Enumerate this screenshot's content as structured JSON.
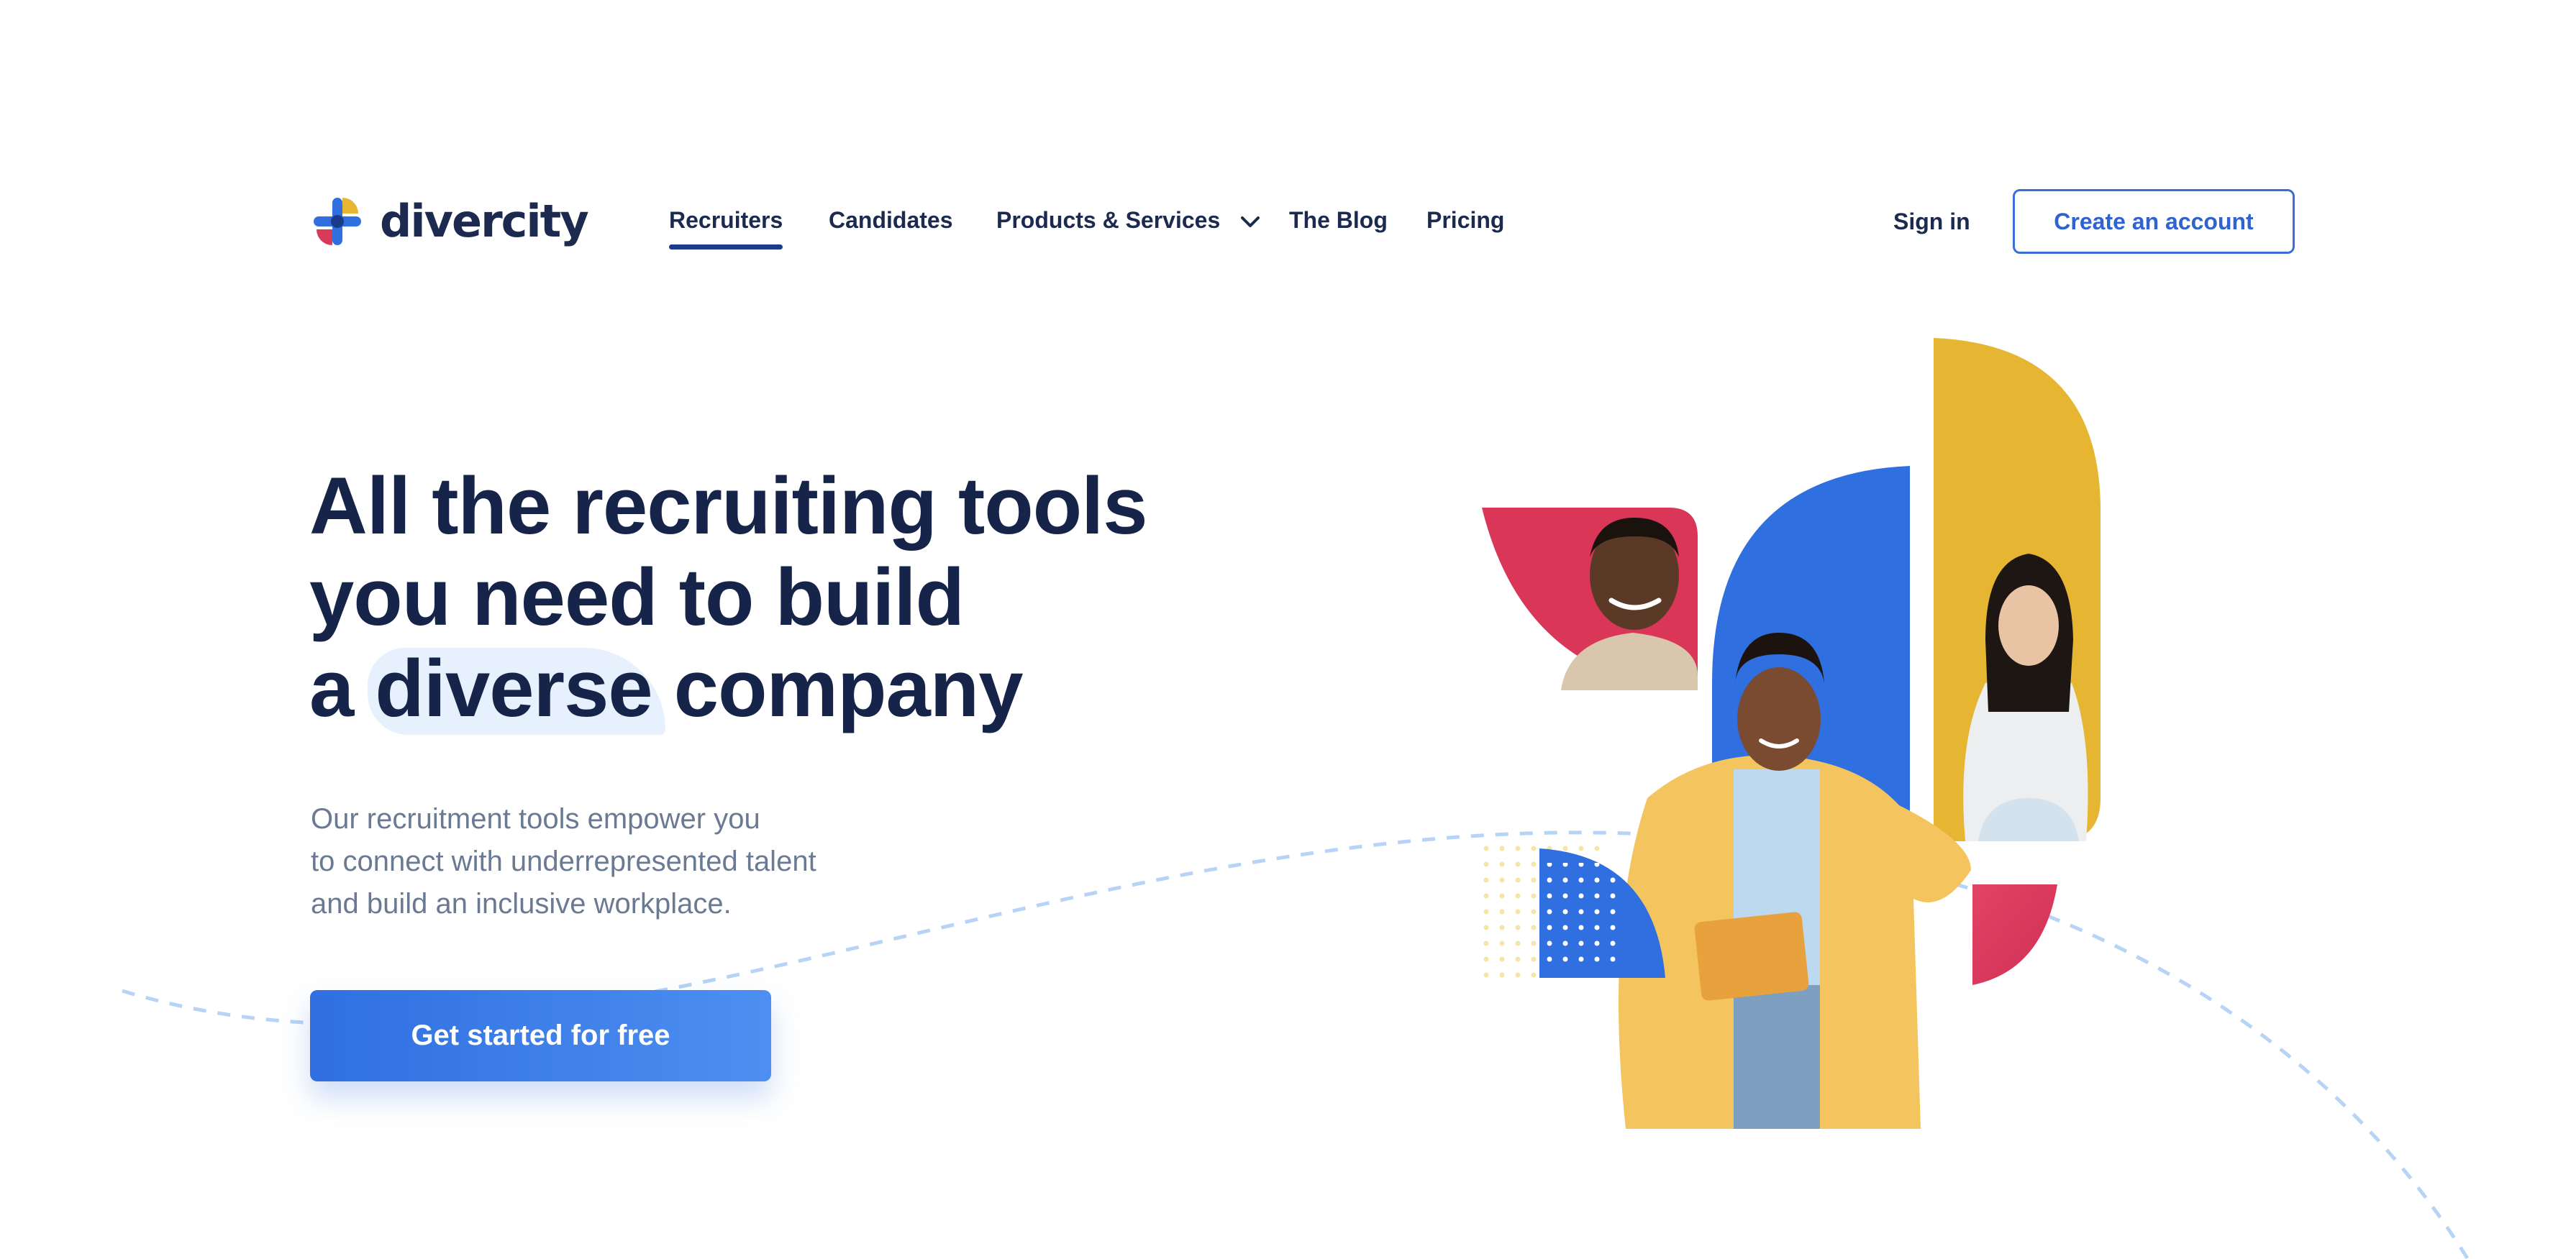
{
  "brand": {
    "name": "divercity",
    "colors": {
      "navy": "#1b2a4e",
      "blue": "#2f6fe0",
      "yellow": "#e6b531",
      "red": "#d83a5a",
      "light_blue": "#e6f1fd"
    }
  },
  "nav": {
    "items": [
      {
        "label": "Recruiters",
        "active": true
      },
      {
        "label": "Candidates",
        "active": false
      },
      {
        "label": "Products & Services",
        "active": false,
        "icon": "chevron-down-icon"
      },
      {
        "label": "The Blog",
        "active": false
      },
      {
        "label": "Pricing",
        "active": false
      }
    ]
  },
  "auth": {
    "sign_in": "Sign in",
    "create_account": "Create an account"
  },
  "hero": {
    "headline_line1": "All the recruiting tools",
    "headline_line2": "you need to build",
    "headline_line3_prefix": "a ",
    "headline_highlight": "diverse",
    "headline_line3_suffix": " company",
    "subtitle_line1": "Our recruitment tools empower you",
    "subtitle_line2": "to connect with underrepresented talent",
    "subtitle_line3": "and build an inclusive workplace.",
    "cta": "Get started for free"
  }
}
